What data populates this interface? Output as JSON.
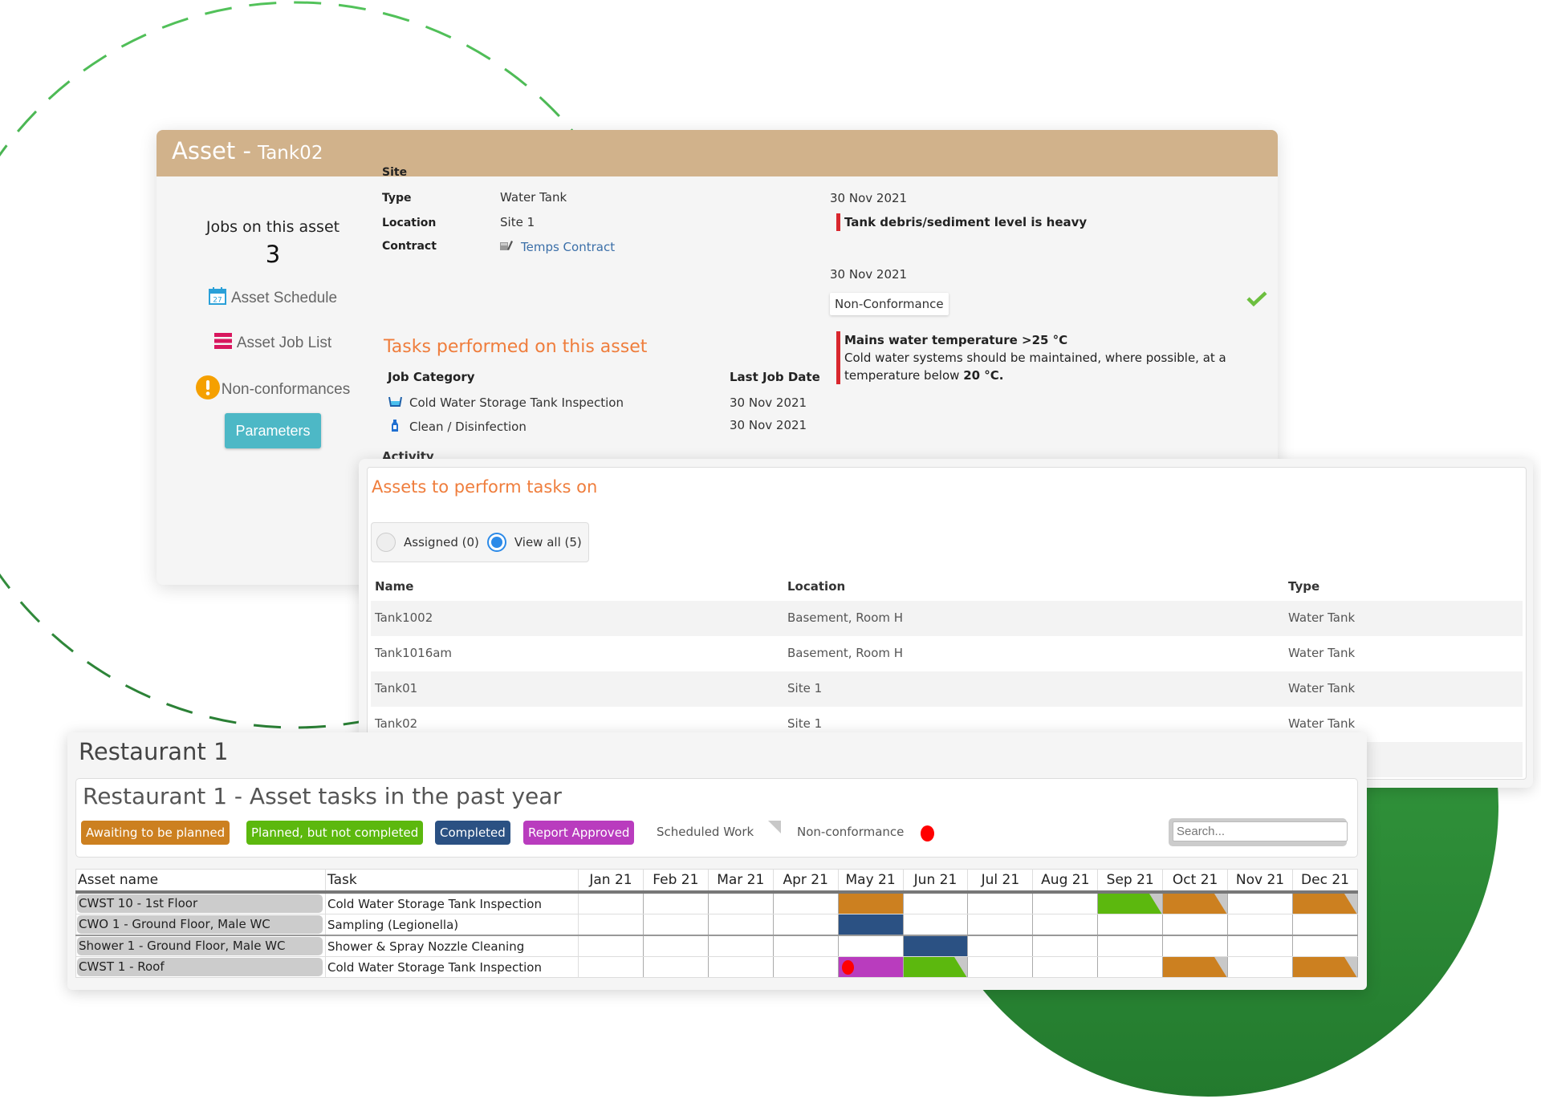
{
  "colors": {
    "header_bg": "#d1b28b",
    "accent_orange": "#ef7d3c",
    "link_blue": "#3b6fa8",
    "button_teal": "#4db8c6",
    "alert_red": "#d9272e",
    "check_green": "#6cbf3f",
    "status": {
      "awaiting": "#cc8020",
      "planned": "#5cb80e",
      "completed": "#2b5183",
      "approved": "#b93cbe"
    },
    "nonconformance_dot": "#ff0000",
    "deco_green": "#2e8b35"
  },
  "asset_panel": {
    "title_prefix": "Asset -",
    "asset_name": "Tank02",
    "jobs_label": "Jobs on this asset",
    "jobs_count": "3",
    "links": {
      "schedule": "Asset Schedule",
      "job_list": "Asset Job List",
      "non_conformances": "Non-conformances"
    },
    "calendar_icon_day": "27",
    "parameters_button": "Parameters",
    "properties": [
      {
        "label": "Site",
        "value": ""
      },
      {
        "label": "Type",
        "value": "Water Tank"
      },
      {
        "label": "Location",
        "value": "Site 1"
      },
      {
        "label": "Contract",
        "value": "Temps Contract"
      }
    ],
    "tasks_heading": "Tasks performed on this asset",
    "tasks_columns": {
      "category": "Job Category",
      "last_date": "Last Job Date"
    },
    "tasks": [
      {
        "category": "Cold Water Storage Tank Inspection",
        "icon": "tank-icon",
        "last_date": "30 Nov 2021"
      },
      {
        "category": "Clean / Disinfection",
        "icon": "spray-bottle-icon",
        "last_date": "30 Nov 2021"
      }
    ],
    "activity_heading_partial": "Activity",
    "nonconformances": [
      {
        "date": "30 Nov 2021",
        "title": "Tank debris/sediment level is heavy"
      },
      {
        "date": "30 Nov 2021",
        "badge": "Non-Conformance",
        "status_icon": "check-icon",
        "title": "Mains water temperature >25 °C",
        "body": "Cold water systems should be maintained, where possible, at a temperature below ",
        "body_bold": "20 °C."
      }
    ]
  },
  "assets_panel": {
    "title": "Assets to perform tasks on",
    "filter": {
      "assigned_label": "Assigned (0)",
      "view_all_label": "View all (5)",
      "selected": "view_all"
    },
    "columns": [
      "Name",
      "Location",
      "Type"
    ],
    "rows": [
      {
        "name": "Tank1002",
        "location": "Basement, Room H",
        "type": "Water Tank"
      },
      {
        "name": "Tank1016am",
        "location": "Basement, Room H",
        "type": "Water Tank"
      },
      {
        "name": "Tank01",
        "location": "Site 1",
        "type": "Water Tank"
      },
      {
        "name": "Tank02",
        "location": "Site 1",
        "type": "Water Tank"
      }
    ]
  },
  "restaurant_panel": {
    "title": "Restaurant 1",
    "subtitle": "Restaurant 1 - Asset tasks in the past year",
    "legend": {
      "awaiting": "Awaiting to be planned",
      "planned": "Planned, but not completed",
      "completed": "Completed",
      "approved": "Report Approved",
      "scheduled": "Scheduled Work",
      "nonconformance": "Non-conformance"
    },
    "search_placeholder": "Search...",
    "columns": {
      "asset": "Asset name",
      "task": "Task"
    },
    "months": [
      "Jan 21",
      "Feb 21",
      "Mar 21",
      "Apr 21",
      "May 21",
      "Jun 21",
      "Jul 21",
      "Aug 21",
      "Sep 21",
      "Oct 21",
      "Nov 21",
      "Dec 21"
    ],
    "rows": [
      {
        "asset": "CWST 10 - 1st Floor",
        "task": "Cold Water Storage Tank Inspection",
        "cells": [
          null,
          null,
          null,
          null,
          {
            "status": "awaiting",
            "scheduled": false,
            "nc": false
          },
          null,
          null,
          null,
          {
            "status": "planned",
            "scheduled": true,
            "nc": false
          },
          {
            "status": "awaiting",
            "scheduled": true,
            "nc": false
          },
          null,
          {
            "status": "awaiting",
            "scheduled": true,
            "nc": false
          }
        ]
      },
      {
        "asset": "CWO 1 - Ground Floor, Male WC",
        "task": "Sampling (Legionella)",
        "cells": [
          null,
          null,
          null,
          null,
          {
            "status": "completed",
            "scheduled": false,
            "nc": false
          },
          null,
          null,
          null,
          null,
          null,
          null,
          null
        ]
      },
      {
        "asset": "Shower 1 - Ground Floor, Male WC",
        "task": "Shower & Spray Nozzle Cleaning",
        "group_start": true,
        "cells": [
          null,
          null,
          null,
          null,
          null,
          {
            "status": "completed",
            "scheduled": false,
            "nc": false
          },
          null,
          null,
          null,
          null,
          null,
          null
        ]
      },
      {
        "asset": "CWST 1 - Roof",
        "task": "Cold Water Storage Tank Inspection",
        "cells": [
          null,
          null,
          null,
          null,
          {
            "status": "approved",
            "scheduled": false,
            "nc": true
          },
          {
            "status": "planned",
            "scheduled": true,
            "nc": false
          },
          null,
          null,
          null,
          {
            "status": "awaiting",
            "scheduled": true,
            "nc": false
          },
          null,
          {
            "status": "awaiting",
            "scheduled": true,
            "nc": false
          }
        ]
      }
    ]
  }
}
